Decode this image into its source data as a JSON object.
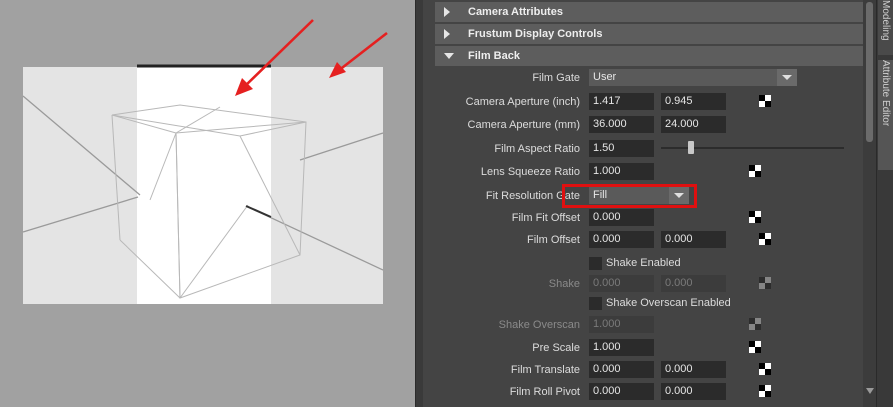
{
  "sections": {
    "camera_attributes": "Camera Attributes",
    "frustum_display_controls": "Frustum Display Controls",
    "film_back": "Film Back"
  },
  "film_gate": {
    "label": "Film Gate",
    "value": "User"
  },
  "camera_aperture_inch": {
    "label": "Camera Aperture (inch)",
    "v1": "1.417",
    "v2": "0.945"
  },
  "camera_aperture_mm": {
    "label": "Camera Aperture (mm)",
    "v1": "36.000",
    "v2": "24.000"
  },
  "film_aspect_ratio": {
    "label": "Film Aspect Ratio",
    "value": "1.50"
  },
  "lens_squeeze_ratio": {
    "label": "Lens Squeeze Ratio",
    "value": "1.000"
  },
  "fit_resolution_gate": {
    "label": "Fit Resolution Gate",
    "value": "Fill"
  },
  "film_fit_offset": {
    "label": "Film Fit Offset",
    "value": "0.000"
  },
  "film_offset": {
    "label": "Film Offset",
    "v1": "0.000",
    "v2": "0.000"
  },
  "shake_enabled": {
    "label": "Shake Enabled"
  },
  "shake": {
    "label": "Shake",
    "v1": "0.000",
    "v2": "0.000"
  },
  "shake_overscan_enabled": {
    "label": "Shake Overscan Enabled"
  },
  "shake_overscan": {
    "label": "Shake Overscan",
    "value": "1.000"
  },
  "pre_scale": {
    "label": "Pre Scale",
    "value": "1.000"
  },
  "film_translate": {
    "label": "Film Translate",
    "v1": "0.000",
    "v2": "0.000"
  },
  "film_roll_pivot": {
    "label": "Film Roll Pivot",
    "v1": "0.000",
    "v2": "0.000"
  },
  "side_tabs": {
    "tab1": "Modeling",
    "tab2": "Attribute Editor"
  },
  "colors": {
    "highlight": "#e01010",
    "annotation_arrow": "#e52020"
  }
}
